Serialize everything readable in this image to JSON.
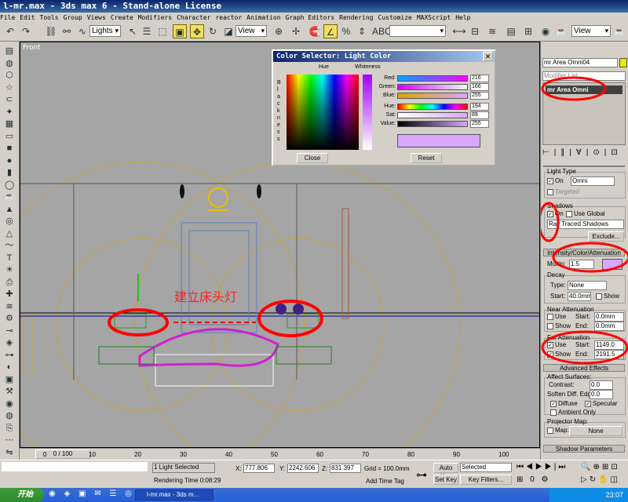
{
  "window": {
    "title": "l-mr.max - 3ds max 6 - Stand-alone License"
  },
  "menu": [
    "File",
    "Edit",
    "Tools",
    "Group",
    "Views",
    "Create",
    "Modifiers",
    "Character",
    "reactor",
    "Animation",
    "Graph Editors",
    "Rendering",
    "Customize",
    "MAXScript",
    "Help"
  ],
  "toolbar": {
    "selection_filter": "Lights",
    "ref_coord": "View",
    "named_sel": "",
    "view2": "View"
  },
  "viewport": {
    "label": "Front",
    "annotation": "建立床头灯"
  },
  "color_selector": {
    "title": "Color Selector: Light Color",
    "hue_label": "Hue",
    "whiteness_label": "Whiteness",
    "blackness_label": "B l a c k n e s s",
    "rows": [
      {
        "name": "Red:",
        "value": "216",
        "gradient": "linear-gradient(90deg,#00a6ff,#ff00ff)"
      },
      {
        "name": "Green:",
        "value": "166",
        "gradient": "linear-gradient(90deg,#d800ff,#e8ffff)"
      },
      {
        "name": "Blue:",
        "value": "255",
        "gradient": "linear-gradient(90deg,#d8a600,#d8a6ff)"
      },
      {
        "name": "Hue:",
        "value": "194",
        "gradient": "linear-gradient(90deg,#f00,#ff0,#0f0,#0ff,#00f,#f0f,#f00)"
      },
      {
        "name": "Sat:",
        "value": "89",
        "gradient": "linear-gradient(90deg,#fff,#d8a6ff)"
      },
      {
        "name": "Value:",
        "value": "255",
        "gradient": "linear-gradient(90deg,#000,#d8a6ff)"
      }
    ],
    "close_label": "Close",
    "reset_label": "Reset",
    "swatch_color": "#d8a6ff"
  },
  "command_panel": {
    "object_name": "mr Area Omni04",
    "modifier_list": "Modifier List",
    "stack_item": "mr Area Omni",
    "light_type_title": "Light Type",
    "on_label": "On",
    "type_value": "Omni",
    "targeted_label": "Targeted",
    "shadows_title": "Shadows",
    "shadows_on_label": "On",
    "use_global_label": "Use Global",
    "shadow_type": "Ray Traced Shadows",
    "exclude_label": "Exclude...",
    "intensity_title": "Intensity/Color/Attenuation",
    "multiplier_label": "Multip:",
    "multiplier_value": "1.5",
    "light_color": "#d8a6ff",
    "decay_title": "Decay",
    "decay_type_label": "Type:",
    "decay_type_value": "None",
    "decay_start_label": "Start:",
    "decay_start_value": "40.0mm",
    "decay_show_label": "Show",
    "near_atten_title": "Near Attenuation",
    "near_use_label": "Use",
    "near_start_label": "Start:",
    "near_start_value": "0.0mm",
    "near_show_label": "Show",
    "near_end_label": "End:",
    "near_end_value": "0.0mm",
    "far_atten_title": "Far Attenuation",
    "far_use_label": "Use",
    "far_start_label": "Start:",
    "far_start_value": "1149.0",
    "far_show_label": "Show",
    "far_end_label": "End:",
    "far_end_value": "2191.5",
    "advanced_effects_title": "Advanced Effects",
    "affect_surfaces_title": "Affect Surfaces:",
    "contrast_label": "Contrast:",
    "contrast_value": "0.0",
    "soften_label": "Soften Diff. Edge:",
    "soften_value": "0.0",
    "diffuse_label": "Diffuse",
    "specular_label": "Specular",
    "ambient_label": "Ambient Only",
    "projector_title": "Projector Map:",
    "map_label": "Map:",
    "map_value": "None",
    "shadow_params_title": "Shadow Parameters"
  },
  "timeline": {
    "frame": "0 / 100",
    "ticks": [
      "0",
      "10",
      "20",
      "30",
      "40",
      "50",
      "60",
      "70",
      "80",
      "90",
      "100"
    ]
  },
  "status": {
    "selection": "1 Light Selected",
    "rendering_time": "Rendering Time  0:08:29",
    "x_label": "X:",
    "x_value": "777.806",
    "y_label": "Y:",
    "y_value": "2242.606",
    "z_label": "Z:",
    "z_value": "831.397",
    "grid": "Grid = 100.0mm",
    "add_time_tag": "Add Time Tag",
    "auto_key": "Auto Key",
    "set_key": "Set Key",
    "key_mode": "Selected",
    "key_filters": "Key Filters..."
  },
  "taskbar": {
    "start": "开始",
    "task": "l-mr.max - 3ds m...",
    "time": "23:07"
  }
}
